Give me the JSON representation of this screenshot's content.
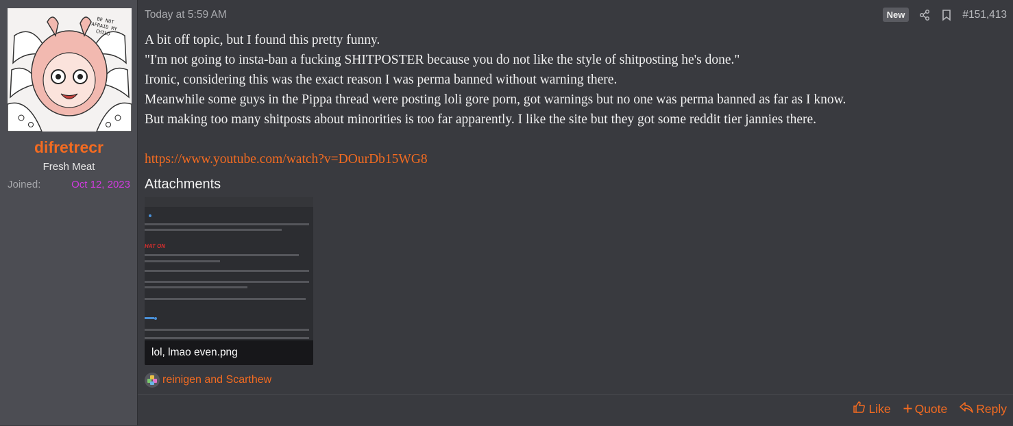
{
  "user": {
    "name": "difretrecr",
    "title": "Fresh Meat",
    "joined_label": "Joined:",
    "joined_value": "Oct 12, 2023",
    "avatar_caption": "BE NOT AFRAID MY CHILD",
    "name_color": "#f36b21"
  },
  "post": {
    "timestamp": "Today at 5:59 AM",
    "badge": "New",
    "number": "#151,413",
    "icons": [
      "share-icon",
      "bookmark-icon"
    ],
    "lines": [
      "A bit off topic, but I found this pretty funny.",
      "\"I'm not going to insta-ban a fucking SHITPOSTER because you do not like the style of shitposting he's done.\"",
      "Ironic, considering this was the exact reason I was perma banned without warning there.",
      "Meanwhile some guys in the Pippa thread were posting loli gore porn, got warnings but no one was perma banned as far as I know.",
      "But making too many shitposts about minorities is too far apparently. I like the site but they got some reddit tier jannies there."
    ],
    "link": "https://www.youtube.com/watch?v=DOurDb15WG8",
    "attachments_title": "Attachments",
    "attachment": {
      "filename": "lol, lmao even.png",
      "thumb_heading": "HAT ON"
    },
    "reactions_text": "reinigen and Scarthew"
  },
  "actions": {
    "like": "Like",
    "quote": "Quote",
    "reply": "Reply"
  },
  "colors": {
    "accent": "#f36b21",
    "joined": "#d23be0",
    "sidebar": "#4c4d53",
    "background": "#393a3f"
  }
}
